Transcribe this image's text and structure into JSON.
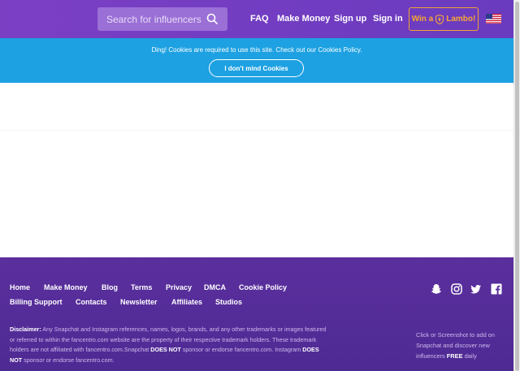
{
  "header": {
    "search_placeholder": "Search for influencers",
    "nav": [
      "FAQ",
      "Make Money",
      "Sign up",
      "Sign in"
    ],
    "lambo_prefix": "Win a",
    "lambo_suffix": "Lambo!",
    "colors": {
      "bg": "#7b3fc4",
      "accent": "#f7a832"
    }
  },
  "cookie": {
    "message": "Ding! Cookies are required to use this site. Check out our Cookies Policy.",
    "button": "I don't mind Cookies",
    "color": "#1da1e2"
  },
  "footer": {
    "links_row1": [
      "Home",
      "Make Money",
      "Blog",
      "Terms",
      "Privacy",
      "DMCA",
      "Cookie Policy"
    ],
    "links_row2": [
      "Billing Support",
      "Contacts",
      "Newsletter",
      "Affiliates",
      "Studios"
    ],
    "social_icons": [
      "snapchat-icon",
      "instagram-icon",
      "twitter-icon",
      "facebook-icon"
    ],
    "disclaimer": {
      "label": "Disclaimer:",
      "part1": " Any Snapchat and Instagram references, names, logos, brands, and any other trademarks or images featured or referred to within the fancentro.com website are the property of their respective trademark holders. These trademark holders are not affiliated with fancentro.com.Snapchat ",
      "bold1": "DOES NOT",
      "part2": " sponsor or endorse fancentro.com. Instagram ",
      "bold2": "DOES NOT",
      "part3": " sponsor or endorse fancentro.com."
    },
    "add_note": {
      "part1": "Click or Screenshot to add on Snapchat and discover new influencers ",
      "bold": "FREE",
      "part2": " daily"
    }
  }
}
